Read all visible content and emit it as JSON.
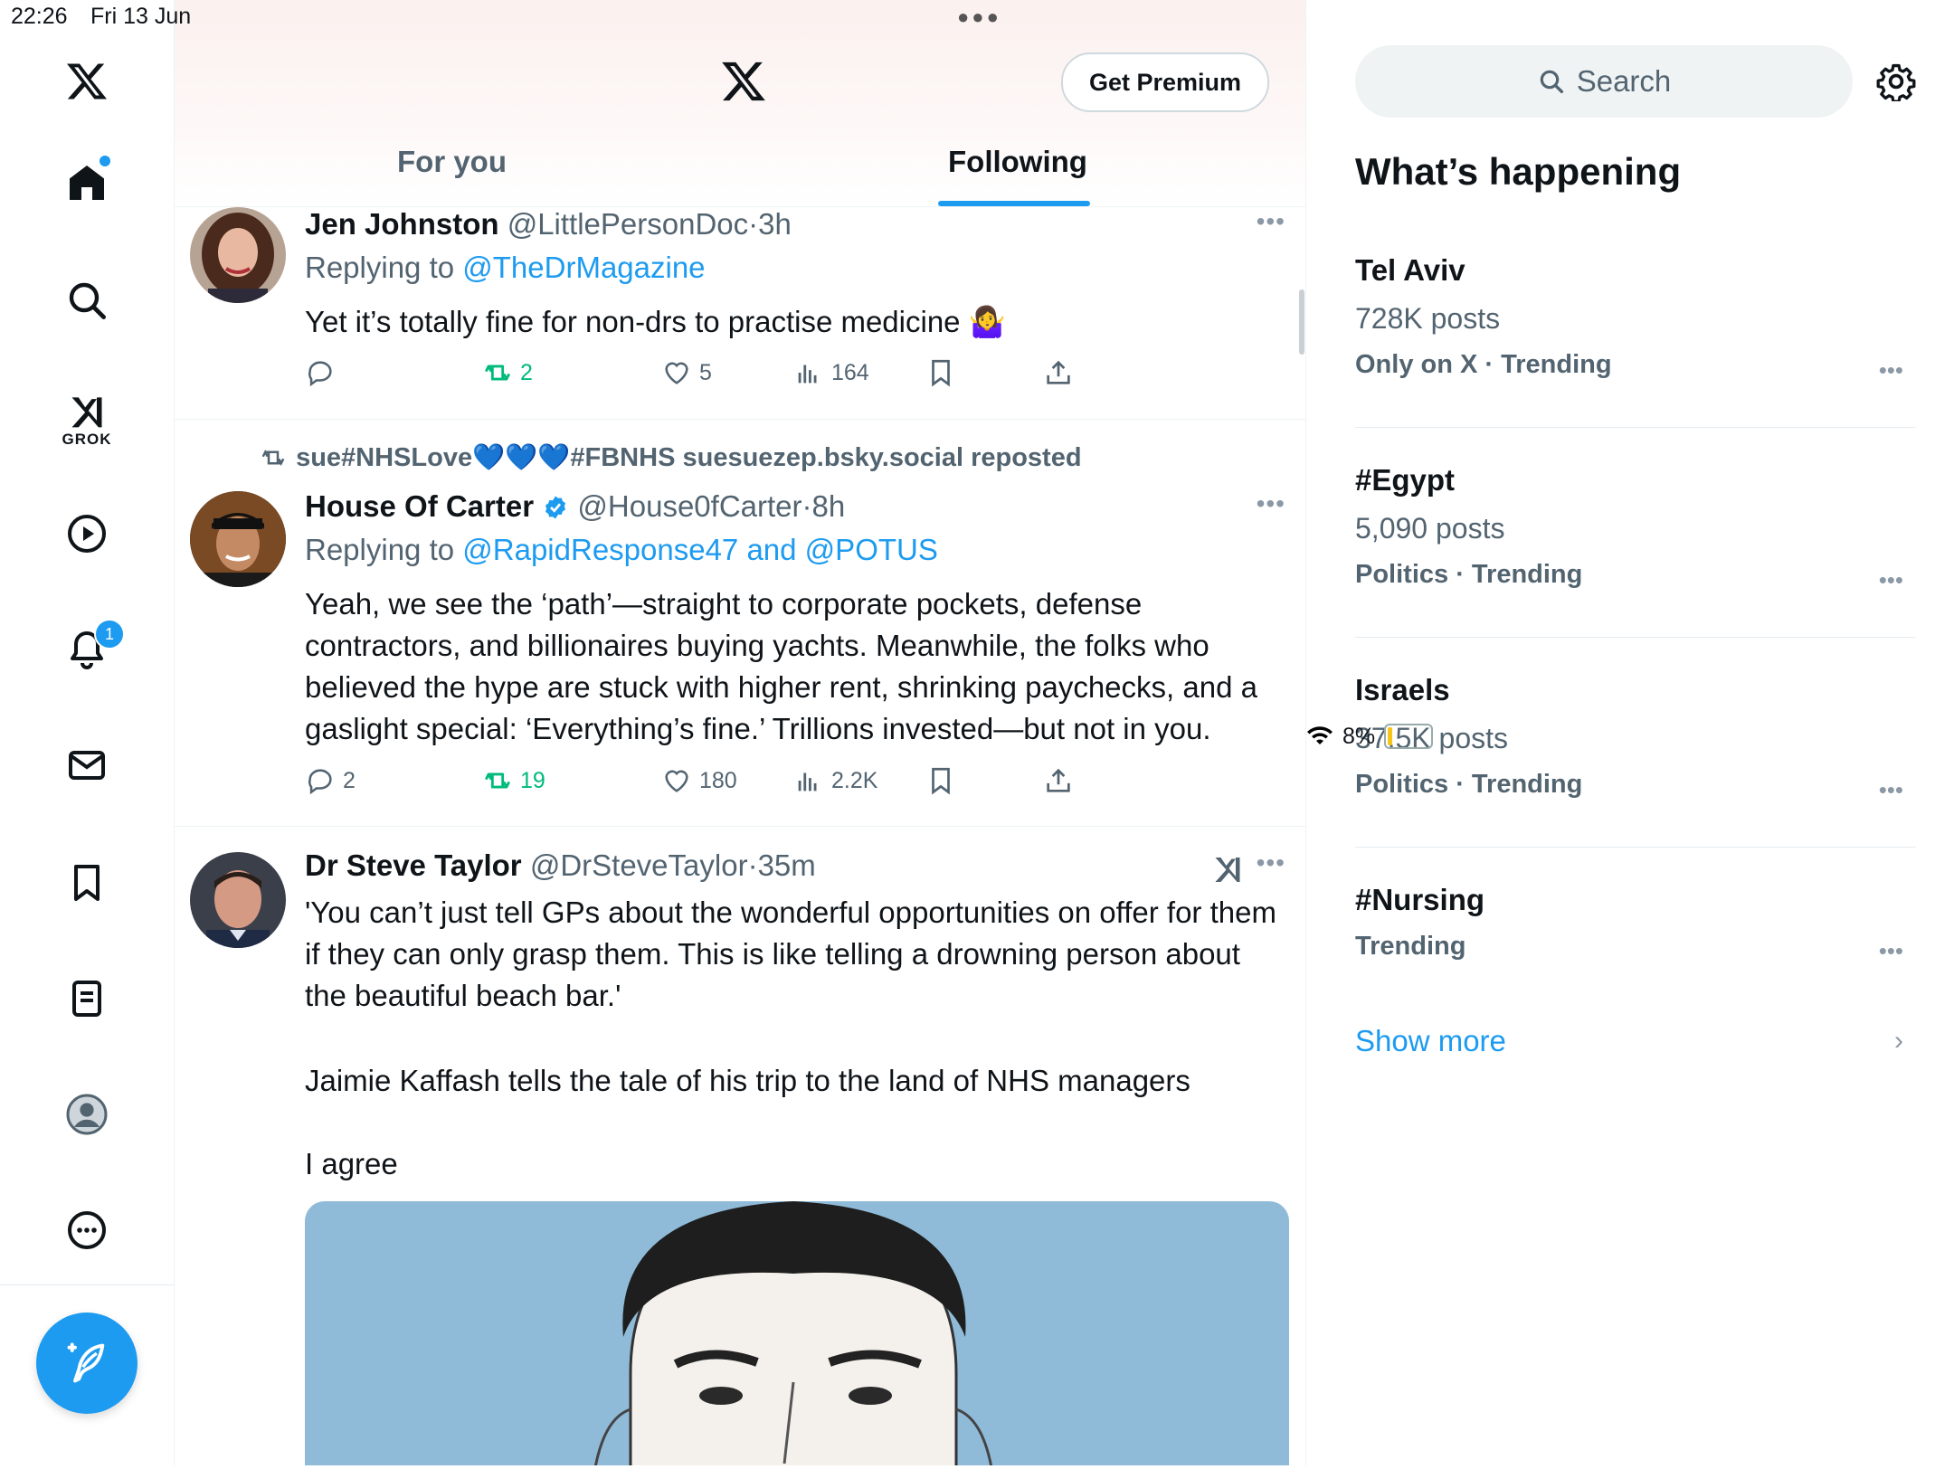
{
  "status_bar": {
    "time": "22:26",
    "date": "Fri 13 Jun",
    "battery": "8%"
  },
  "nav": {
    "grok_label": "GROK",
    "notifications_count": "1"
  },
  "header": {
    "premium_label": "Get Premium",
    "tabs": [
      "For you",
      "Following"
    ],
    "active_tab": "Following"
  },
  "posts": [
    {
      "name": "Jen Johnston",
      "handle": "@LittlePersonDoc",
      "time": "3h",
      "replying_prefix": "Replying to ",
      "replying_to": "@TheDrMagazine",
      "text": "Yet it’s totally fine for non-drs to practise medicine 🤷‍♀️",
      "replies": "",
      "reposts": "2",
      "likes": "5",
      "views": "164"
    },
    {
      "repost_banner": "sue#NHSLove💙💙💙#FBNHS suesuezep.bsky.social reposted",
      "name": "House Of Carter",
      "handle": "@House0fCarter",
      "time": "8h",
      "replying_prefix": "Replying to ",
      "replying_to": "@RapidResponse47 and @POTUS",
      "text": "Yeah, we see the ‘path’—straight to corporate pockets, defense contractors, and billionaires buying yachts. Meanwhile, the folks who believed the hype are stuck with higher rent, shrinking paychecks, and a gaslight special: ‘Everything’s fine.’ Trillions invested—but not in you.",
      "replies": "2",
      "reposts": "19",
      "likes": "180",
      "views": "2.2K"
    },
    {
      "name": "Dr Steve Taylor",
      "handle": "@DrSteveTaylor",
      "time": "35m",
      "text_p1": "'You can’t just tell GPs about the wonderful opportunities on offer for them if they can only grasp them. This is like telling a drowning person about the beautiful beach bar.'",
      "text_p2": "Jaimie Kaffash tells the tale of his trip to the land of NHS managers",
      "text_p3": "I agree"
    }
  ],
  "sidebar": {
    "search_placeholder": "Search",
    "title": "What’s happening",
    "trends": [
      {
        "name": "Tel Aviv",
        "posts": "728K posts",
        "context": "Only on X · Trending"
      },
      {
        "name": "#Egypt",
        "posts": "5,090 posts",
        "context": "Politics · Trending"
      },
      {
        "name": "Israels",
        "posts": "37.5K posts",
        "context": "Politics · Trending"
      },
      {
        "name": "#Nursing",
        "posts": "",
        "context": "Trending"
      }
    ],
    "show_more": "Show more"
  }
}
